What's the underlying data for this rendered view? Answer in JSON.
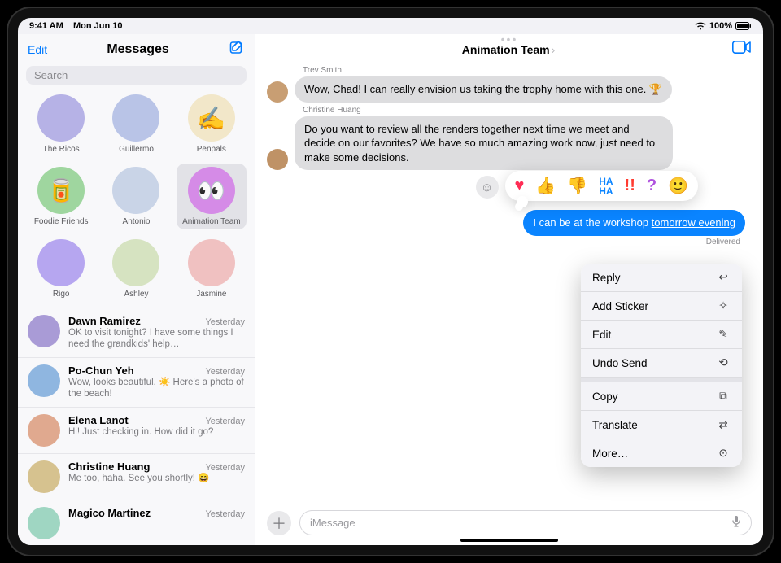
{
  "statusbar": {
    "time": "9:41 AM",
    "date": "Mon Jun 10",
    "battery": "100%"
  },
  "sidebar": {
    "edit": "Edit",
    "title": "Messages",
    "search_placeholder": "Search",
    "pinned": [
      {
        "label": "The Ricos",
        "color": "#b6b2e6"
      },
      {
        "label": "Guillermo",
        "color": "#b9c4e7"
      },
      {
        "label": "Penpals",
        "color": "#f2e7c9",
        "emoji": "✍️"
      },
      {
        "label": "Foodie Friends",
        "color": "#9fd69f",
        "emoji": "🥫"
      },
      {
        "label": "Antonio",
        "color": "#c9d4e7"
      },
      {
        "label": "Animation Team",
        "color": "#d58be7",
        "emoji": "👀",
        "selected": true
      },
      {
        "label": "Rigo",
        "color": "#b6a6f0"
      },
      {
        "label": "Ashley",
        "color": "#d6e3c1"
      },
      {
        "label": "Jasmine",
        "color": "#f0c1c1"
      }
    ],
    "conversations": [
      {
        "name": "Dawn Ramirez",
        "time": "Yesterday",
        "preview": "OK to visit tonight? I have some things I need the grandkids' help…",
        "color": "#a99bd6"
      },
      {
        "name": "Po-Chun Yeh",
        "time": "Yesterday",
        "preview": "Wow, looks beautiful. ☀️ Here's a photo of the beach!",
        "color": "#8fb6e0"
      },
      {
        "name": "Elena Lanot",
        "time": "Yesterday",
        "preview": "Hi! Just checking in. How did it go?",
        "color": "#e0a98f"
      },
      {
        "name": "Christine Huang",
        "time": "Yesterday",
        "preview": "Me too, haha. See you shortly! 😄",
        "color": "#d6c28f"
      },
      {
        "name": "Magico Martinez",
        "time": "Yesterday",
        "preview": "",
        "color": "#9fd6c2"
      }
    ]
  },
  "chat": {
    "title": "Animation Team",
    "messages": [
      {
        "sender": "Trev Smith",
        "text": "Wow, Chad! I can really envision us taking the trophy home with this one. 🏆"
      },
      {
        "sender": "Christine Huang",
        "text": "Do you want to review all the renders together next time we meet and decide on our favorites? We have so much amazing work now, just need to make some decisions."
      }
    ],
    "out": {
      "text_part1": "I can be at the workshop ",
      "text_underlined": "tomorrow evening",
      "delivered": "Delivered"
    },
    "composer_placeholder": "iMessage"
  },
  "tapback": {
    "heart": "♥",
    "thumbs_up": "👍",
    "thumbs_down": "👎",
    "haha": "HA\nHA",
    "exclaim": "!!",
    "question": "?",
    "emoji": "🙂"
  },
  "ctx": {
    "reply": "Reply",
    "add_sticker": "Add Sticker",
    "edit": "Edit",
    "undo_send": "Undo Send",
    "copy": "Copy",
    "translate": "Translate",
    "more": "More…"
  }
}
